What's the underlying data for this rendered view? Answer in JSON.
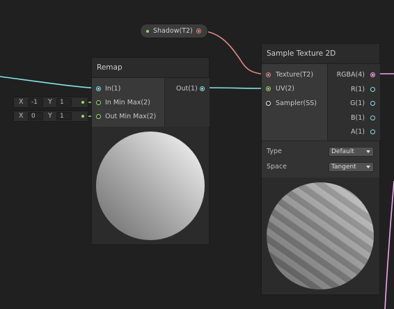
{
  "property_node": {
    "label": "Shadow(T2)",
    "port_color": "#e58a8a"
  },
  "remap_node": {
    "title": "Remap",
    "inputs": [
      {
        "label": "In(1)",
        "color": "#84e4e7"
      },
      {
        "label": "In Min Max(2)",
        "color": "#9ad96e"
      },
      {
        "label": "Out Min Max(2)",
        "color": "#9ad96e"
      }
    ],
    "outputs": [
      {
        "label": "Out(1)",
        "color": "#84e4e7"
      }
    ]
  },
  "inline_inputs": [
    {
      "x_label": "X",
      "x_value": "-1",
      "y_label": "Y",
      "y_value": "1"
    },
    {
      "x_label": "X",
      "x_value": "0",
      "y_label": "Y",
      "y_value": "1"
    }
  ],
  "sample_node": {
    "title": "Sample Texture 2D",
    "inputs": [
      {
        "label": "Texture(T2)",
        "color": "#e58a8a"
      },
      {
        "label": "UV(2)",
        "color": "#9ad96e"
      },
      {
        "label": "Sampler(SS)",
        "color": "#ffffff"
      }
    ],
    "outputs": [
      {
        "label": "RGBA(4)",
        "color": "#f2a6f2"
      },
      {
        "label": "R(1)",
        "color": "#84e4e7"
      },
      {
        "label": "G(1)",
        "color": "#84e4e7"
      },
      {
        "label": "B(1)",
        "color": "#84e4e7"
      },
      {
        "label": "A(1)",
        "color": "#84e4e7"
      }
    ],
    "type_label": "Type",
    "type_value": "Default",
    "space_label": "Space",
    "space_value": "Tangent"
  }
}
